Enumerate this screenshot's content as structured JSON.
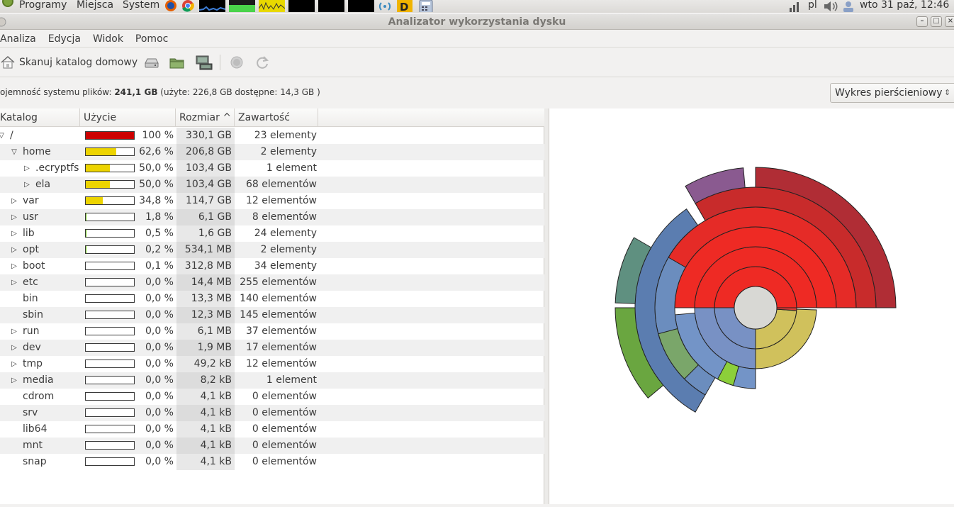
{
  "panel": {
    "apps_menu": "Programy",
    "places_menu": "Miejsca",
    "system_menu": "System",
    "keyboard_layout": "pl",
    "clock": "wto 31 paź, 12:46"
  },
  "window": {
    "title": "Analizator wykorzystania dysku"
  },
  "menubar": {
    "items": [
      "Analiza",
      "Edycja",
      "Widok",
      "Pomoc"
    ]
  },
  "toolbar": {
    "scan_home_label": "Skanuj katalog domowy"
  },
  "infobar": {
    "capacity_prefix": "ojemność systemu plików: ",
    "capacity_total": "241,1 GB",
    "capacity_detail": " (użyte: 226,8 GB dostępne: 14,3 GB )",
    "chart_type": "Wykres pierścieniowy"
  },
  "tree": {
    "columns": [
      "Katalog",
      "Użycie",
      "Rozmiar",
      "Zawartość"
    ],
    "sort_indicator": "^",
    "rows": [
      {
        "name": "/",
        "depth": 0,
        "expander": "open",
        "usage": "100 %",
        "fraction": 1.0,
        "size": "330,1 GB",
        "contents": "23 elementy",
        "color": "#cc0000"
      },
      {
        "name": "home",
        "depth": 1,
        "expander": "open",
        "usage": "62,6 %",
        "fraction": 0.626,
        "size": "206,8 GB",
        "contents": "2 elementy",
        "color": "#edd400"
      },
      {
        "name": ".ecryptfs",
        "depth": 2,
        "expander": "closed",
        "usage": "50,0 %",
        "fraction": 0.5,
        "size": "103,4 GB",
        "contents": "1 element",
        "color": "#edd400"
      },
      {
        "name": "ela",
        "depth": 2,
        "expander": "closed",
        "usage": "50,0 %",
        "fraction": 0.5,
        "size": "103,4 GB",
        "contents": "68 elementów",
        "color": "#edd400"
      },
      {
        "name": "var",
        "depth": 1,
        "expander": "closed",
        "usage": "34,8 %",
        "fraction": 0.348,
        "size": "114,7 GB",
        "contents": "12 elementów",
        "color": "#edd400"
      },
      {
        "name": "usr",
        "depth": 1,
        "expander": "closed",
        "usage": "1,8 %",
        "fraction": 0.018,
        "size": "6,1 GB",
        "contents": "8 elementów",
        "color": "#73d216"
      },
      {
        "name": "lib",
        "depth": 1,
        "expander": "closed",
        "usage": "0,5 %",
        "fraction": 0.005,
        "size": "1,6 GB",
        "contents": "24 elementy",
        "color": "#73d216"
      },
      {
        "name": "opt",
        "depth": 1,
        "expander": "closed",
        "usage": "0,2 %",
        "fraction": 0.002,
        "size": "534,1 MB",
        "contents": "2 elementy",
        "color": "#73d216"
      },
      {
        "name": "boot",
        "depth": 1,
        "expander": "closed",
        "usage": "0,1 %",
        "fraction": 0.001,
        "size": "312,8 MB",
        "contents": "34 elementy",
        "color": "#73d216"
      },
      {
        "name": "etc",
        "depth": 1,
        "expander": "closed",
        "usage": "0,0 %",
        "fraction": 0,
        "size": "14,4 MB",
        "contents": "255 elementów",
        "color": "#73d216"
      },
      {
        "name": "bin",
        "depth": 1,
        "expander": "none",
        "usage": "0,0 %",
        "fraction": 0,
        "size": "13,3 MB",
        "contents": "140 elementów",
        "color": "#73d216"
      },
      {
        "name": "sbin",
        "depth": 1,
        "expander": "none",
        "usage": "0,0 %",
        "fraction": 0,
        "size": "12,3 MB",
        "contents": "145 elementów",
        "color": "#73d216"
      },
      {
        "name": "run",
        "depth": 1,
        "expander": "closed",
        "usage": "0,0 %",
        "fraction": 0,
        "size": "6,1 MB",
        "contents": "37 elementów",
        "color": "#73d216"
      },
      {
        "name": "dev",
        "depth": 1,
        "expander": "closed",
        "usage": "0,0 %",
        "fraction": 0,
        "size": "1,9 MB",
        "contents": "17 elementów",
        "color": "#73d216"
      },
      {
        "name": "tmp",
        "depth": 1,
        "expander": "closed",
        "usage": "0,0 %",
        "fraction": 0,
        "size": "49,2 kB",
        "contents": "12 elementów",
        "color": "#73d216"
      },
      {
        "name": "media",
        "depth": 1,
        "expander": "closed",
        "usage": "0,0 %",
        "fraction": 0,
        "size": "8,2 kB",
        "contents": "1 element",
        "color": "#73d216"
      },
      {
        "name": "cdrom",
        "depth": 1,
        "expander": "none",
        "usage": "0,0 %",
        "fraction": 0,
        "size": "4,1 kB",
        "contents": "0 elementów",
        "color": "#73d216"
      },
      {
        "name": "srv",
        "depth": 1,
        "expander": "none",
        "usage": "0,0 %",
        "fraction": 0,
        "size": "4,1 kB",
        "contents": "0 elementów",
        "color": "#73d216"
      },
      {
        "name": "lib64",
        "depth": 1,
        "expander": "none",
        "usage": "0,0 %",
        "fraction": 0,
        "size": "4,1 kB",
        "contents": "0 elementów",
        "color": "#73d216"
      },
      {
        "name": "mnt",
        "depth": 1,
        "expander": "none",
        "usage": "0,0 %",
        "fraction": 0,
        "size": "4,1 kB",
        "contents": "0 elementów",
        "color": "#73d216"
      },
      {
        "name": "snap",
        "depth": 1,
        "expander": "none",
        "usage": "0,0 %",
        "fraction": 0,
        "size": "4,1 kB",
        "contents": "0 elementów",
        "color": "#73d216"
      }
    ]
  },
  "ring_chart": {
    "center_color": "#d8d8d4",
    "segments": [
      {
        "level": 1,
        "start": -180,
        "end": 0,
        "color": "#ee2a24"
      },
      {
        "level": 1,
        "start": -270,
        "end": -180,
        "color": "#7891c4"
      },
      {
        "level": 1,
        "start": -356,
        "end": -270,
        "color": "#d0c15c"
      },
      {
        "level": 1,
        "start": -360,
        "end": -356,
        "color": "#d93a36"
      },
      {
        "level": 2,
        "start": -180,
        "end": 0,
        "color": "#ee2a24"
      },
      {
        "level": 2,
        "start": -270,
        "end": -180,
        "color": "#7891c4"
      },
      {
        "level": 2,
        "start": -358,
        "end": -270,
        "color": "#d0c15c"
      },
      {
        "level": 3,
        "start": -180,
        "end": 0,
        "color": "#ee2a24"
      },
      {
        "level": 3,
        "start": -270,
        "end": -185,
        "color": "#7394c7"
      },
      {
        "level": 3,
        "start": -254,
        "end": -242,
        "color": "#8ccf3a"
      },
      {
        "level": 4,
        "start": -150,
        "end": 0,
        "color": "#e52b27"
      },
      {
        "level": 4,
        "start": -240,
        "end": -150,
        "color": "#6b8dbe"
      },
      {
        "level": 4,
        "start": -225,
        "end": -195,
        "color": "#7aa66a"
      },
      {
        "level": 5,
        "start": -120,
        "end": 0,
        "color": "#c82b2b"
      },
      {
        "level": 5,
        "start": -240,
        "end": -125,
        "color": "#5b7db0"
      },
      {
        "level": 6,
        "start": -90,
        "end": 0,
        "color": "#b02d35"
      },
      {
        "level": 6,
        "start": -120,
        "end": -95,
        "color": "#8a5a90"
      },
      {
        "level": 6,
        "start": -220,
        "end": -180,
        "color": "#6aa640"
      },
      {
        "level": 6,
        "start": -178,
        "end": -150,
        "color": "#5f9080"
      }
    ]
  }
}
